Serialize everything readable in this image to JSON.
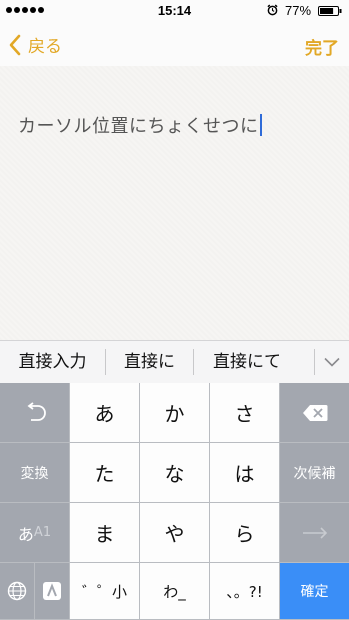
{
  "status": {
    "time": "15:14",
    "battery_percent": "77%",
    "battery_level": 0.77
  },
  "nav": {
    "back_label": "戻る",
    "done_label": "完了",
    "accent_color": "#e2a826"
  },
  "note": {
    "text": "カーソル位置にちょくせつに"
  },
  "candidates": [
    "直接入力",
    "直接に",
    "直接にて"
  ],
  "keyboard": {
    "row1": [
      "あ",
      "か",
      "さ"
    ],
    "row2": [
      "た",
      "な",
      "は"
    ],
    "row3": [
      "ま",
      "や",
      "ら"
    ],
    "row4": [
      "゛゜小",
      "わ_",
      "、。?!"
    ],
    "convert_label": "変換",
    "next_candidate_label": "次候補",
    "mode_kana": "あ",
    "mode_alpha": "A1",
    "confirm_label": "確定",
    "confirm_color": "#3a8ef7"
  }
}
